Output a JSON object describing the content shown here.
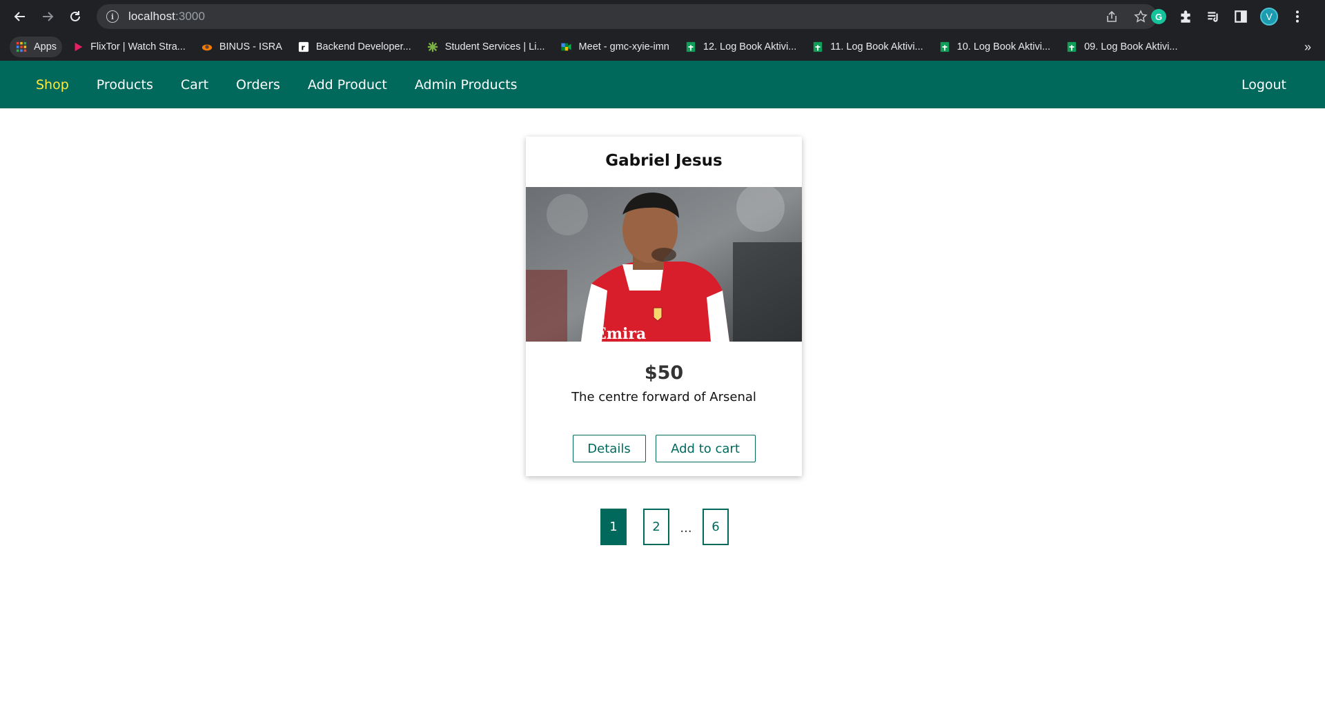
{
  "browser": {
    "url_host": "localhost",
    "url_port": ":3000",
    "profile_initial": "V",
    "bookmarks": [
      {
        "label": "Apps",
        "icon": "apps-grid-icon"
      },
      {
        "label": "FlixTor | Watch Stra...",
        "icon": "flixtor-icon"
      },
      {
        "label": "BINUS - ISRA",
        "icon": "binus-icon"
      },
      {
        "label": "Backend Developer...",
        "icon": "backend-icon"
      },
      {
        "label": "Student Services | Li...",
        "icon": "student-services-icon"
      },
      {
        "label": "Meet - gmc-xyie-imn",
        "icon": "google-meet-icon"
      },
      {
        "label": "12. Log Book Aktivi...",
        "icon": "google-sheets-icon"
      },
      {
        "label": "11. Log Book Aktivi...",
        "icon": "google-sheets-icon"
      },
      {
        "label": "10. Log Book Aktivi...",
        "icon": "google-sheets-icon"
      },
      {
        "label": "09. Log Book Aktivi...",
        "icon": "google-sheets-icon"
      }
    ],
    "more_bookmarks": "»"
  },
  "nav": {
    "shop": "Shop",
    "products": "Products",
    "cart": "Cart",
    "orders": "Orders",
    "add_product": "Add Product",
    "admin_products": "Admin Products",
    "logout": "Logout"
  },
  "product": {
    "title": "Gabriel Jesus",
    "price": "$50",
    "description": "The centre forward of Arsenal",
    "details_label": "Details",
    "add_to_cart_label": "Add to cart"
  },
  "pagination": {
    "current": "1",
    "next": "2",
    "ellipsis": "...",
    "last": "6"
  },
  "colors": {
    "primary": "#00695c",
    "nav_active": "#ffeb3b",
    "chrome_bg": "#202124",
    "omnibox_bg": "#35363a"
  }
}
